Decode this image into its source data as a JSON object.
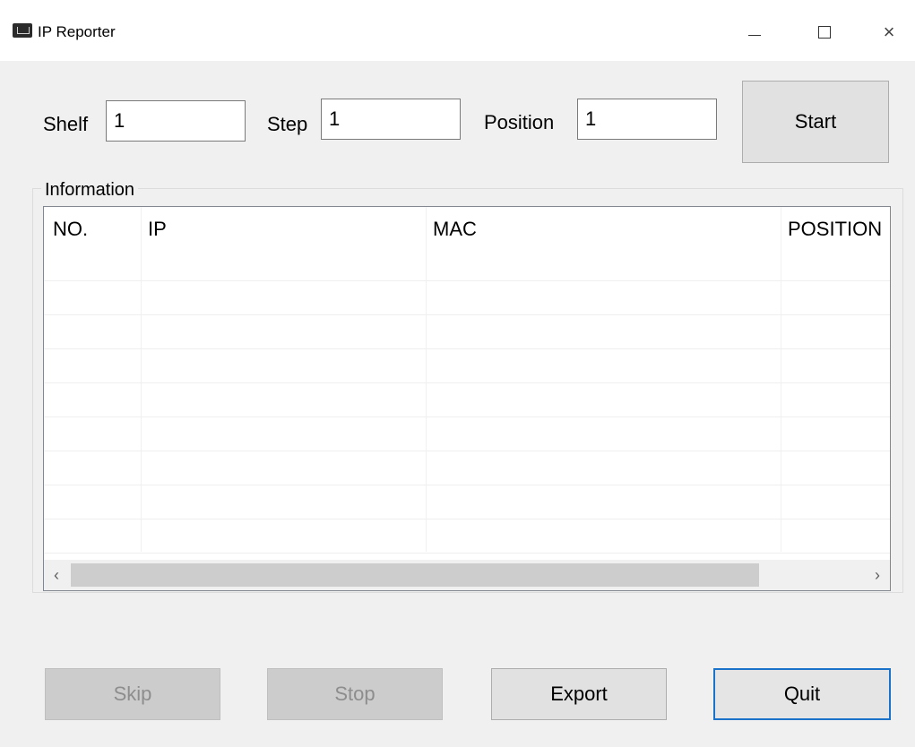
{
  "window": {
    "title": "IP Reporter",
    "minimize_glyph": "",
    "maximize_glyph": "",
    "close_glyph": "×"
  },
  "form": {
    "shelf_label": "Shelf",
    "shelf_value": "1",
    "step_label": "Step",
    "step_value": "1",
    "position_label": "Position",
    "position_value": "1",
    "start_label": "Start"
  },
  "information": {
    "group_label": "Information",
    "columns": [
      "NO.",
      "IP",
      "MAC",
      "POSITION"
    ],
    "rows": [],
    "scroll_left_glyph": "‹",
    "scroll_right_glyph": "›"
  },
  "actions": {
    "skip_label": "Skip",
    "stop_label": "Stop",
    "export_label": "Export",
    "quit_label": "Quit"
  },
  "icons": {
    "app": "app-window-icon",
    "minimize": "minimize-icon",
    "maximize": "maximize-icon",
    "close": "close-icon"
  },
  "colors": {
    "background": "#f0f0f0",
    "focus_border": "#1a73c8",
    "disabled_text": "#8d8d8d"
  }
}
